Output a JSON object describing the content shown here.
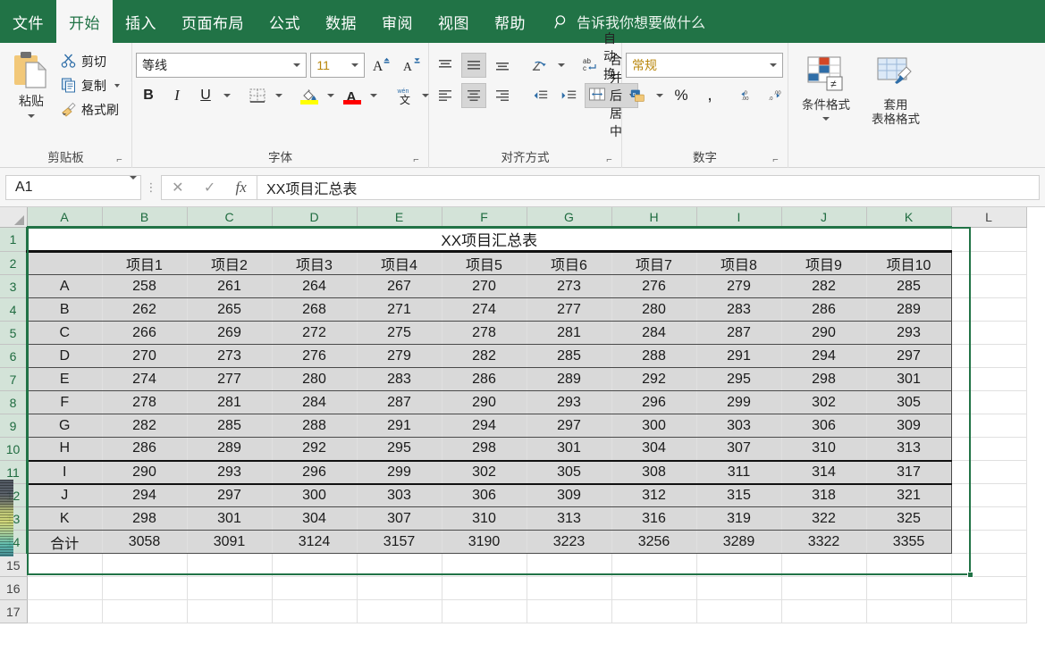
{
  "app": {
    "accent": "#217346",
    "ribbon_tabs": [
      {
        "label": "文件",
        "active": false
      },
      {
        "label": "开始",
        "active": true
      },
      {
        "label": "插入",
        "active": false
      },
      {
        "label": "页面布局",
        "active": false
      },
      {
        "label": "公式",
        "active": false
      },
      {
        "label": "数据",
        "active": false
      },
      {
        "label": "审阅",
        "active": false
      },
      {
        "label": "视图",
        "active": false
      },
      {
        "label": "帮助",
        "active": false
      }
    ],
    "tell_me": "告诉我你想要做什么"
  },
  "ribbon": {
    "clipboard": {
      "group_label": "剪贴板",
      "paste": "粘贴",
      "cut": "剪切",
      "copy": "复制",
      "format_painter": "格式刷"
    },
    "font": {
      "group_label": "字体",
      "font_name": "等线",
      "font_size": "11",
      "bold": "B",
      "italic": "I",
      "underline": "U",
      "grow_font": "A",
      "shrink_font": "A",
      "phonetic": "文"
    },
    "alignment": {
      "group_label": "对齐方式",
      "wrap_text": "自动换行",
      "merge_center": "合并后居中"
    },
    "number": {
      "group_label": "数字",
      "number_format": "常规",
      "percent": "%",
      "comma": ",",
      "increase_decimal": ".00",
      "decrease_decimal": ".00"
    },
    "styles": {
      "conditional_format": "条件格式",
      "format_as_table_line1": "套用",
      "format_as_table_line2": "表格格式"
    }
  },
  "formula_bar": {
    "name_box": "A1",
    "cancel_icon": "✕",
    "enter_icon": "✓",
    "function_icon": "fx",
    "formula_value": "XX项目汇总表"
  },
  "grid": {
    "column_headers": [
      "A",
      "B",
      "C",
      "D",
      "E",
      "F",
      "G",
      "H",
      "I",
      "J",
      "K",
      "L"
    ],
    "selected_columns": [
      "A",
      "B",
      "C",
      "D",
      "E",
      "F",
      "G",
      "H",
      "I",
      "J",
      "K"
    ],
    "row_headers": [
      "1",
      "2",
      "3",
      "4",
      "5",
      "6",
      "7",
      "8",
      "9",
      "10",
      "11",
      "12",
      "13",
      "14",
      "15",
      "16",
      "17"
    ],
    "selected_rows": [
      "1",
      "2",
      "3",
      "4",
      "5",
      "6",
      "7",
      "8",
      "9",
      "10",
      "11",
      "12",
      "13",
      "14"
    ],
    "selection_range": "A1:K14",
    "title_cell": "XX项目汇总表",
    "table_header": [
      "",
      "项目1",
      "项目2",
      "项目3",
      "项目4",
      "项目5",
      "项目6",
      "项目7",
      "项目8",
      "项目9",
      "项目10"
    ],
    "table_rows": [
      [
        "A",
        "258",
        "261",
        "264",
        "267",
        "270",
        "273",
        "276",
        "279",
        "282",
        "285"
      ],
      [
        "B",
        "262",
        "265",
        "268",
        "271",
        "274",
        "277",
        "280",
        "283",
        "286",
        "289"
      ],
      [
        "C",
        "266",
        "269",
        "272",
        "275",
        "278",
        "281",
        "284",
        "287",
        "290",
        "293"
      ],
      [
        "D",
        "270",
        "273",
        "276",
        "279",
        "282",
        "285",
        "288",
        "291",
        "294",
        "297"
      ],
      [
        "E",
        "274",
        "277",
        "280",
        "283",
        "286",
        "289",
        "292",
        "295",
        "298",
        "301"
      ],
      [
        "F",
        "278",
        "281",
        "284",
        "287",
        "290",
        "293",
        "296",
        "299",
        "302",
        "305"
      ],
      [
        "G",
        "282",
        "285",
        "288",
        "291",
        "294",
        "297",
        "300",
        "303",
        "306",
        "309"
      ],
      [
        "H",
        "286",
        "289",
        "292",
        "295",
        "298",
        "301",
        "304",
        "307",
        "310",
        "313"
      ],
      [
        "I",
        "290",
        "293",
        "296",
        "299",
        "302",
        "305",
        "308",
        "311",
        "314",
        "317"
      ],
      [
        "J",
        "294",
        "297",
        "300",
        "303",
        "306",
        "309",
        "312",
        "315",
        "318",
        "321"
      ],
      [
        "K",
        "298",
        "301",
        "304",
        "307",
        "310",
        "313",
        "316",
        "319",
        "322",
        "325"
      ]
    ],
    "total_row": [
      "合计",
      "3058",
      "3091",
      "3124",
      "3157",
      "3190",
      "3223",
      "3256",
      "3289",
      "3322",
      "3355"
    ],
    "empty_rows": [
      "15",
      "16",
      "17"
    ]
  }
}
